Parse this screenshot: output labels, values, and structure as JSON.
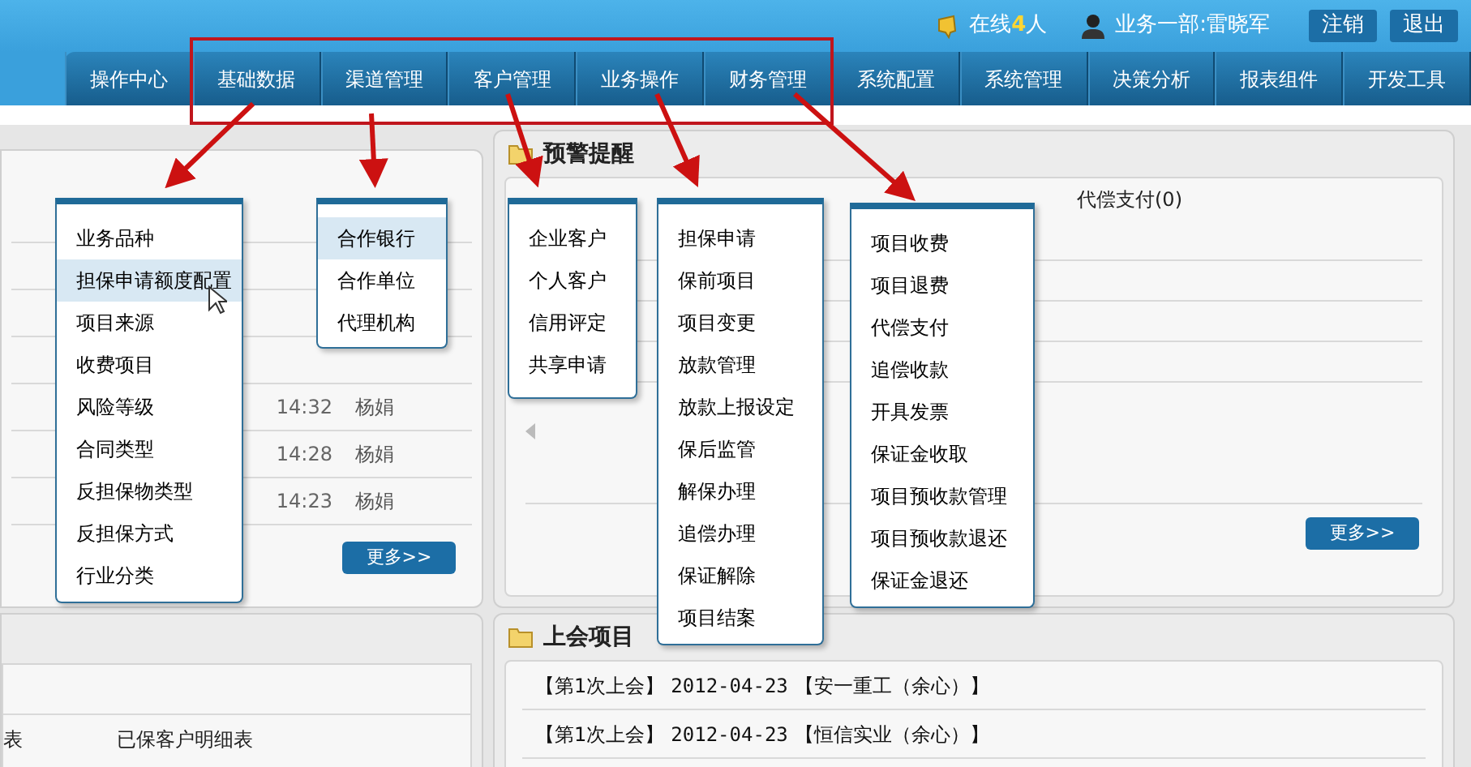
{
  "header": {
    "online_label": "在线",
    "online_count": "4",
    "online_unit": "人",
    "user": "业务一部:雷晓军",
    "buttons": [
      "注销",
      "退出"
    ]
  },
  "nav": {
    "items": [
      "操作中心",
      "基础数据",
      "渠道管理",
      "客户管理",
      "业务操作",
      "财务管理",
      "系统配置",
      "系统管理",
      "决策分析",
      "报表组件",
      "开发工具"
    ]
  },
  "menus": [
    {
      "items": [
        {
          "label": "业务品种",
          "selected": false
        },
        {
          "label": "担保申请额度配置",
          "selected": true
        },
        {
          "label": "项目来源",
          "selected": false
        },
        {
          "label": "收费项目",
          "selected": false
        },
        {
          "label": "风险等级",
          "selected": false
        },
        {
          "label": "合同类型",
          "selected": false
        },
        {
          "label": "反担保物类型",
          "selected": false
        },
        {
          "label": "反担保方式",
          "selected": false
        },
        {
          "label": "行业分类",
          "selected": false
        }
      ]
    },
    {
      "items": [
        {
          "label": "合作银行",
          "selected": true
        },
        {
          "label": "合作单位",
          "selected": false
        },
        {
          "label": "代理机构",
          "selected": false
        }
      ]
    },
    {
      "items": [
        {
          "label": "企业客户",
          "selected": false
        },
        {
          "label": "个人客户",
          "selected": false
        },
        {
          "label": "信用评定",
          "selected": false
        },
        {
          "label": "共享申请",
          "selected": false
        }
      ]
    },
    {
      "items": [
        {
          "label": "担保申请",
          "selected": false
        },
        {
          "label": "保前项目",
          "selected": false
        },
        {
          "label": "项目变更",
          "selected": false
        },
        {
          "label": "放款管理",
          "selected": false
        },
        {
          "label": "放款上报设定",
          "selected": false
        },
        {
          "label": "保后监管",
          "selected": false
        },
        {
          "label": "解保办理",
          "selected": false
        },
        {
          "label": "追偿办理",
          "selected": false
        },
        {
          "label": "保证解除",
          "selected": false
        },
        {
          "label": "项目结案",
          "selected": false
        }
      ]
    },
    {
      "items": [
        {
          "label": "项目收费",
          "selected": false
        },
        {
          "label": "项目退费",
          "selected": false
        },
        {
          "label": "代偿支付",
          "selected": false
        },
        {
          "label": "追偿收款",
          "selected": false
        },
        {
          "label": "开具发票",
          "selected": false
        },
        {
          "label": "保证金收取",
          "selected": false
        },
        {
          "label": "项目预收款管理",
          "selected": false
        },
        {
          "label": "项目预收款退还",
          "selected": false
        },
        {
          "label": "保证金退还",
          "selected": false
        }
      ]
    }
  ],
  "left_panel": {
    "rows": [
      {
        "time": "14:32",
        "name": "杨娟"
      },
      {
        "time": "14:28",
        "name": "杨娟"
      },
      {
        "time": "14:23",
        "name": "杨娟"
      }
    ],
    "more_button": "更多>>"
  },
  "warning_panel": {
    "title": "预警提醒",
    "tabs": [
      "代偿支付(0)"
    ],
    "more_button": "更多>>"
  },
  "bottom_left": {
    "cells": [
      "表",
      "已保客户明细表"
    ]
  },
  "meeting_panel": {
    "title": "上会项目",
    "rows": [
      {
        "round": "【第1次上会】",
        "date": "2012-04-23",
        "project": "【安一重工（余心）】"
      },
      {
        "round": "【第1次上会】",
        "date": "2012-04-23",
        "project": "【恒信实业（余心）】"
      }
    ]
  }
}
